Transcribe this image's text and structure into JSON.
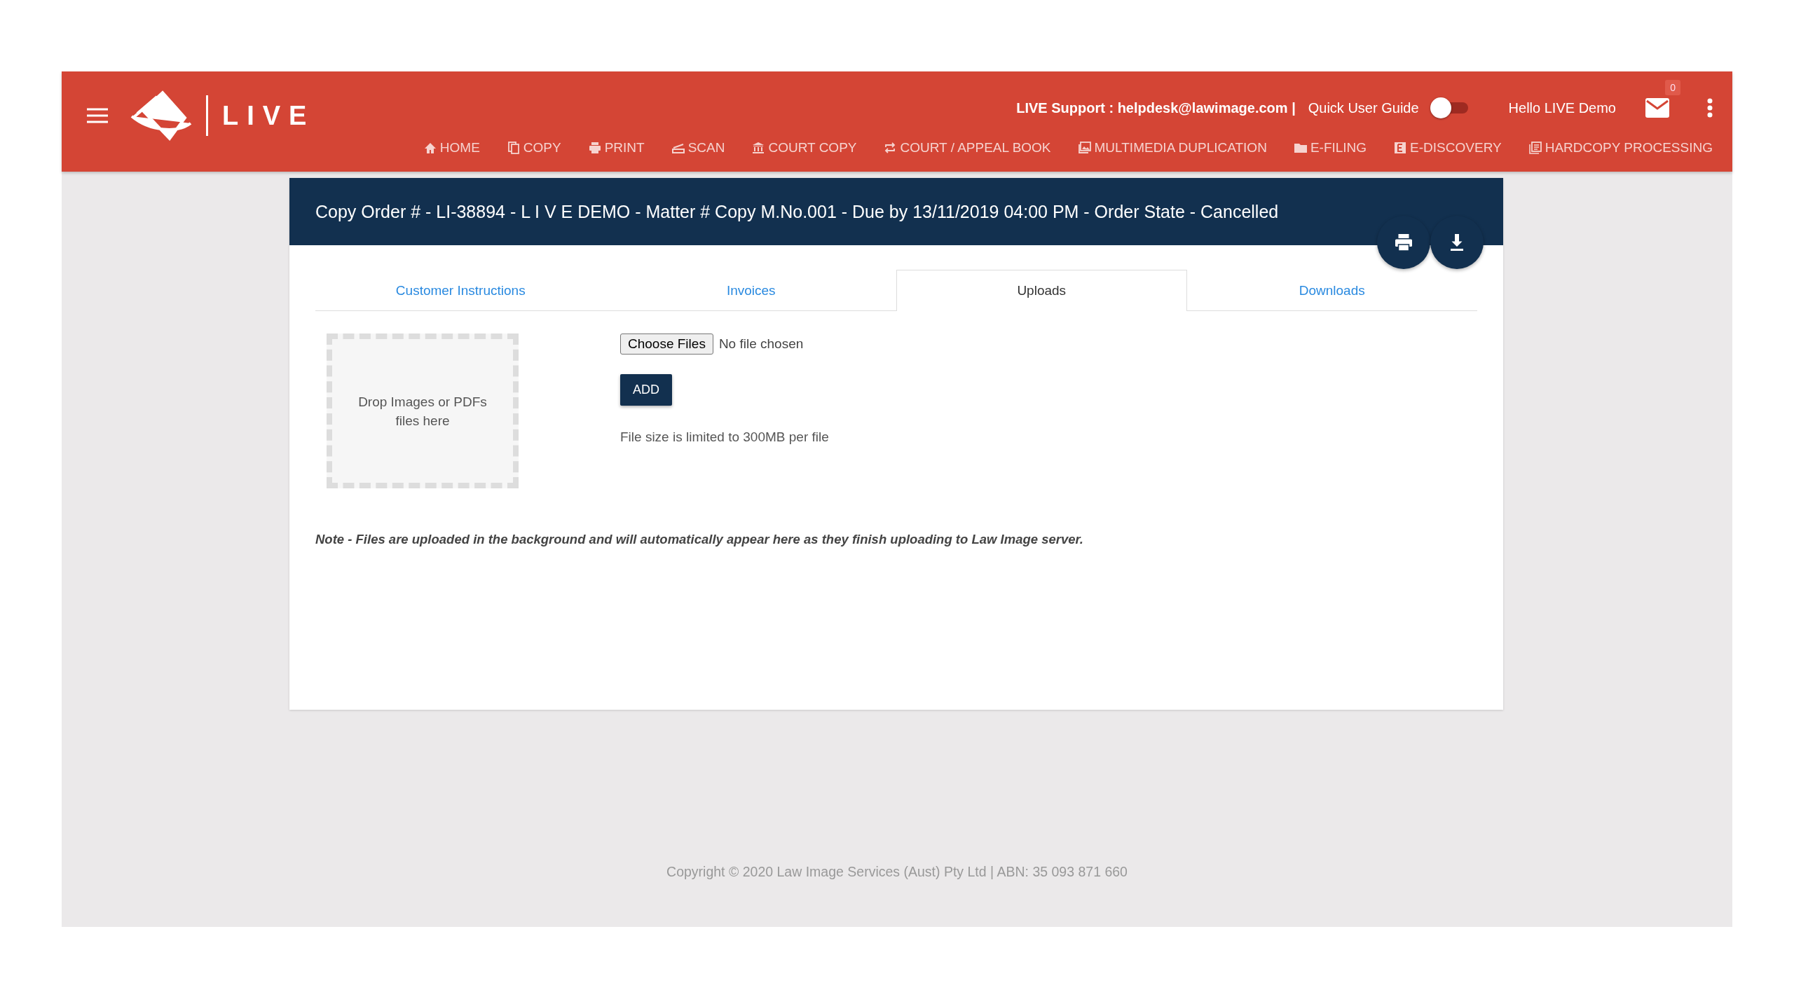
{
  "header": {
    "brand": "LIVE",
    "support_label": "LIVE Support :",
    "support_email": "helpdesk@lawimage.com",
    "support_separator": "|",
    "guide": {
      "label": "Quick User Guide",
      "on": false
    },
    "greeting": "Hello LIVE Demo",
    "mail_count": "0"
  },
  "nav": [
    {
      "label": "HOME",
      "kind": "home"
    },
    {
      "label": "COPY",
      "kind": "copy"
    },
    {
      "label": "PRINT",
      "kind": "print"
    },
    {
      "label": "SCAN",
      "kind": "scan"
    },
    {
      "label": "COURT COPY",
      "kind": "court"
    },
    {
      "label": "COURT / APPEAL BOOK",
      "kind": "repeat"
    },
    {
      "label": "MULTIMEDIA DUPLICATION",
      "kind": "media"
    },
    {
      "label": "E-FILING",
      "kind": "folder"
    },
    {
      "label": "E-DISCOVERY",
      "kind": "letter"
    },
    {
      "label": "HARDCOPY PROCESSING",
      "kind": "doc"
    }
  ],
  "order": {
    "title": "Copy Order # - LI-38894 - L I V E DEMO - Matter # Copy M.No.001 - Due by 13/11/2019 04:00 PM - Order State - Cancelled"
  },
  "tabs": [
    {
      "label": "Customer Instructions",
      "selected": false
    },
    {
      "label": "Invoices",
      "selected": false
    },
    {
      "label": "Uploads",
      "selected": true
    },
    {
      "label": "Downloads",
      "selected": false
    }
  ],
  "upload": {
    "drop_zone": "Drop Images or PDFs files here",
    "choose_button": "Choose Files",
    "file_status": "No file chosen",
    "add_button": "ADD",
    "size_note": "File size is limited to 300MB per file"
  },
  "note": "Note - Files are uploaded in the background and will automatically appear here as they finish uploading to Law Image server.",
  "footer": "Copyright © 2020 Law Image Services (Aust) Pty Ltd | ABN: 35 093 871 660"
}
